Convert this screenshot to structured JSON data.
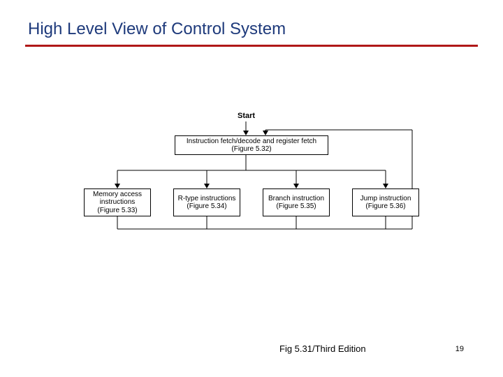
{
  "title": "High Level View of Control System",
  "diagram": {
    "start": "Start",
    "top": {
      "line1": "Instruction fetch/decode and register fetch",
      "line2": "(Figure 5.32)"
    },
    "leaves": [
      {
        "line1": "Memory access",
        "line2": "instructions",
        "line3": "(Figure 5.33)"
      },
      {
        "line1": "R-type instructions",
        "line2": "(Figure 5.34)",
        "line3": ""
      },
      {
        "line1": "Branch instruction",
        "line2": "(Figure 5.35)",
        "line3": ""
      },
      {
        "line1": "Jump instruction",
        "line2": "(Figure 5.36)",
        "line3": ""
      }
    ]
  },
  "caption": "Fig 5.31/Third Edition",
  "page": "19"
}
